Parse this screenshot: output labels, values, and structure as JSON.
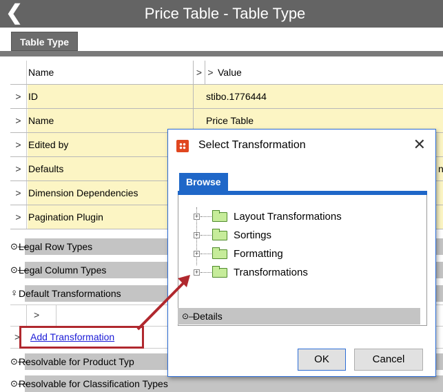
{
  "window": {
    "title": "Price Table - Table Type",
    "back_icon": "back-chevron-icon"
  },
  "tab": {
    "label": "Table Type"
  },
  "table": {
    "header": {
      "name": "Name",
      "value": "Value"
    },
    "rows": [
      {
        "name": "ID",
        "value": "stibo.1776444"
      },
      {
        "name": "Name",
        "value": "Price Table"
      },
      {
        "name": "Edited by",
        "value": ""
      },
      {
        "name": "Defaults",
        "value": "n:"
      },
      {
        "name": "Dimension Dependencies",
        "value": ""
      },
      {
        "name": "Pagination Plugin",
        "value": ""
      }
    ]
  },
  "sections": {
    "legal_row_types": "Legal Row Types",
    "legal_column_types": "Legal Column Types",
    "default_transformations": "Default Transformations",
    "resolvable_product": "Resolvable for Product Typ",
    "resolvable_classification": "Resolvable for Classification Types"
  },
  "add_transformation": "Add Transformation",
  "dialog": {
    "title": "Select Transformation",
    "tab": "Browse",
    "tree": [
      "Layout Transformations",
      "Sortings",
      "Formatting",
      "Transformations"
    ],
    "details": "Details",
    "ok": "OK",
    "cancel": "Cancel"
  },
  "colors": {
    "highlight_row": "#fcf5c4",
    "dialog_accent": "#1f67c8",
    "annotation_red": "#b0282e"
  }
}
